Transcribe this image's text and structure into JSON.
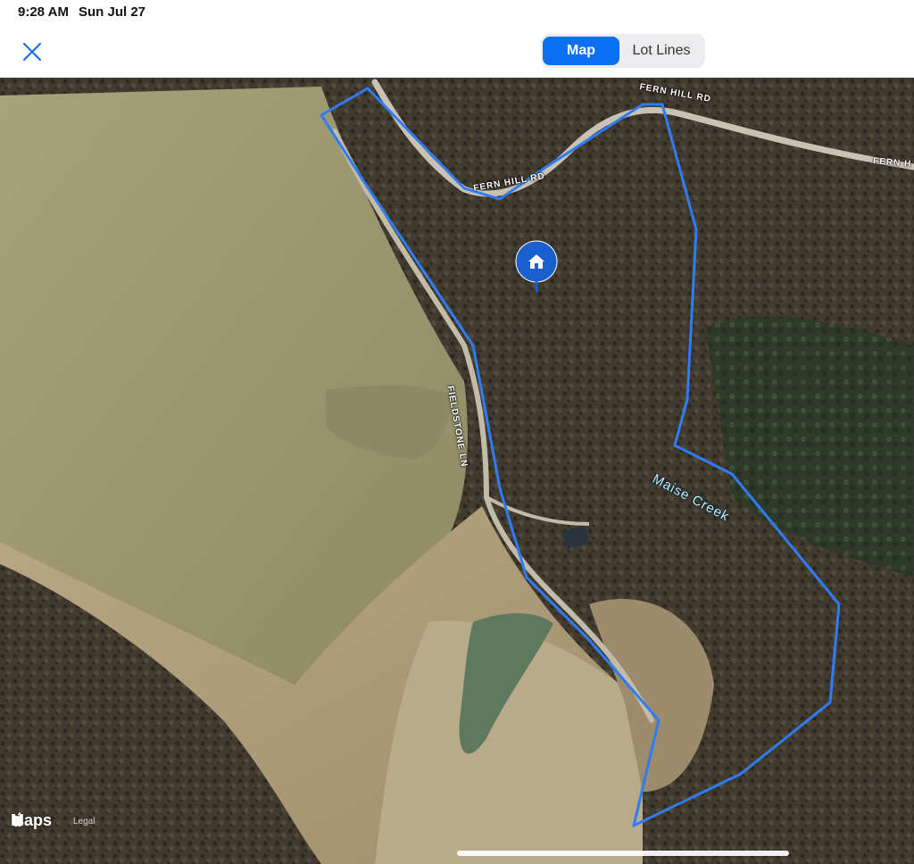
{
  "status_bar": {
    "time": "9:28 AM",
    "date": "Sun Jul 27"
  },
  "header": {
    "close_icon": "close-icon",
    "tabs": [
      {
        "label": "Map",
        "selected": true
      },
      {
        "label": "Lot Lines",
        "selected": false
      }
    ]
  },
  "map": {
    "road_labels": [
      "FERN HILL RD",
      "FERN HILL RD",
      "FERN H",
      "FIELDSTONE LN"
    ],
    "creek_label": "Maise Creek",
    "pin_icon": "home-icon",
    "attribution": {
      "brand": "Maps",
      "legal": "Legal"
    }
  },
  "colors": {
    "accent": "#0a6ff0",
    "boundary": "#2f7df6",
    "pin": "#1a5fd0"
  }
}
